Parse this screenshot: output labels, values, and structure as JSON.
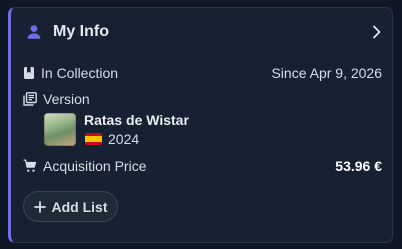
{
  "card": {
    "title": "My Info",
    "accent_color": "#6f6ee9",
    "icons": {
      "header": "person-icon",
      "chevron": "chevron-right-icon",
      "collection": "bookmark-icon",
      "version": "library-books-icon",
      "price": "shopping-cart-icon",
      "flag": "spain-flag-icon",
      "add": "plus-icon"
    }
  },
  "in_collection": {
    "label": "In Collection",
    "value": "Since Apr 9, 2026"
  },
  "version": {
    "label": "Version",
    "name": "Ratas de Wistar",
    "year": "2024"
  },
  "acquisition": {
    "label": "Acquisition Price",
    "value": "53.96 €"
  },
  "actions": {
    "add_list": "Add List"
  }
}
